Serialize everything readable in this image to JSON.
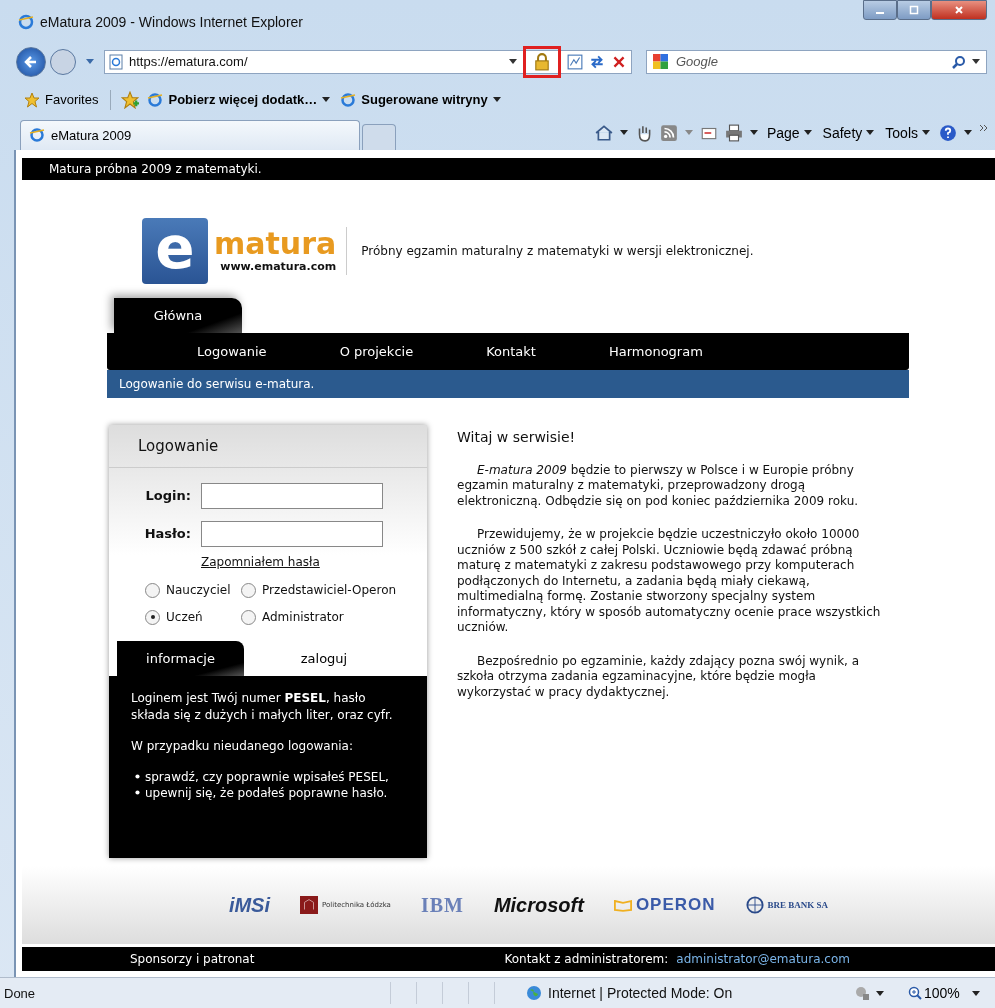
{
  "window": {
    "title": "eMatura 2009 - Windows Internet Explorer"
  },
  "address_bar": {
    "url": "https://ematura.com/",
    "search_placeholder": "Google",
    "lock_highlighted": true
  },
  "favorites_bar": {
    "items": [
      "Favorites",
      "Pobierz więcej dodatk…",
      "Sugerowane witryny"
    ]
  },
  "tabs": [
    {
      "label": "eMatura 2009",
      "selected": true
    },
    {
      "selected": false
    }
  ],
  "command_bar": {
    "menus": [
      "Page",
      "Safety",
      "Tools"
    ]
  },
  "page": {
    "top_bar": "Matura próbna 2009 z matematyki.",
    "logo": {
      "letter": "e",
      "name": "matura",
      "url": "www.ematura.com"
    },
    "tagline": "Próbny egzamin maturalny z matematyki w wersji elektronicznej.",
    "main_tabs": [
      {
        "label": "Główna",
        "selected": true
      }
    ],
    "nav": [
      "Logowanie",
      "O projekcie",
      "Kontakt",
      "Harmonogram"
    ],
    "breadcrumb": "Logowanie do serwisu e-matura.",
    "login": {
      "title": "Logowanie",
      "fields": [
        {
          "label": "Login:"
        },
        {
          "label": "Hasło:"
        }
      ],
      "forgot_link": "Zapomniałem hasła",
      "roles": [
        {
          "label": "Nauczyciel",
          "selected": false
        },
        {
          "label": "Przedstawiciel-Operon",
          "selected": false
        },
        {
          "label": "Uczeń",
          "selected": true
        },
        {
          "label": "Administrator",
          "selected": false
        }
      ],
      "tabs": [
        {
          "label": "informacje",
          "selected": true
        },
        {
          "label": "zaloguj",
          "selected": false
        }
      ],
      "info": [
        "Loginem jest Twój numer **PESEL**, hasło składa się z dużych i małych liter, oraz cyfr.",
        "W przypadku nieudanego logowania:"
      ],
      "bullets": [
        "sprawdź, czy poprawnie wpisałeś PESEL,",
        "upewnij się, że podałeś poprawne hasło."
      ]
    },
    "article": {
      "heading": "Witaj w serwisie!",
      "paragraphs": [
        "*E-matura 2009* będzie to pierwszy w Polsce i w Europie próbny egzamin maturalny z matematyki, przeprowadzony drogą elektroniczną. Odbędzie się on pod koniec października 2009 roku.",
        "Przewidujemy, że w projekcie będzie uczestniczyło około 10000 uczniów z 500 szkół z całej Polski. Uczniowie będą zdawać próbną maturę z matematyki z zakresu podstawowego przy komputerach podłączonych do Internetu, a zadania będą miały ciekawą, multimedialną formę. Zostanie stworzony specjalny system informatyczny, który w sposób automatyczny ocenie prace wszystkich uczniów.",
        "Bezpośrednio po egzaminie, każdy zdający pozna swój wynik, a szkoła otrzyma zadania egzaminacyjne, które będzie mogła wykorzystać w pracy dydaktycznej."
      ]
    },
    "sponsors": [
      {
        "name": "iMSi",
        "kind": "imsi"
      },
      {
        "name": "Politechnika Łódzka",
        "kind": "crest"
      },
      {
        "name": "IBM",
        "kind": "ibm"
      },
      {
        "name": "Microsoft",
        "kind": "ms"
      },
      {
        "name": "OPERON",
        "kind": "operon"
      },
      {
        "name": "BRE BANK SA",
        "kind": "bre"
      }
    ],
    "footer": {
      "sponsors_label": "Sponsorzy i patronat",
      "contact_label": "Kontakt z administratorem:",
      "email": "administrator@ematura.com"
    }
  },
  "status_bar": {
    "text": "Done",
    "zone": "Internet | Protected Mode: On",
    "zoom": "100%"
  }
}
